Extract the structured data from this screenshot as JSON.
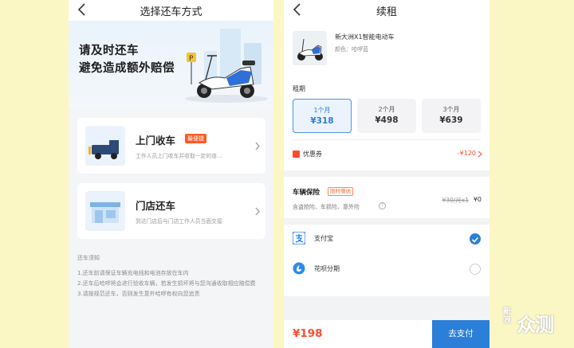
{
  "left": {
    "title": "选择还车方式",
    "banner": {
      "line1": "请及时还车",
      "line2": "避免造成额外赔偿"
    },
    "options": [
      {
        "title": "上门收车",
        "badge": "最便捷",
        "desc": "工作人员上门收车并收取一定的谘..."
      },
      {
        "title": "门店还车",
        "badge": "",
        "desc": "到达门店后与门店工作人员当面交接"
      }
    ],
    "notes": {
      "heading": "还车须知",
      "items": [
        "1.还车前请保证车辆充电线和电池存放在车内",
        "2.还车后哈啰将会进行验收车辆，若发生损坏将与您沟通收取相应赔偿费",
        "3.请按规范还车，否则发生意外哈啰有权向您追责"
      ]
    }
  },
  "right": {
    "title": "续租",
    "product": {
      "name": "新大洲X1智能电动车",
      "color": "颜色：哈啰蓝"
    },
    "rent": {
      "label": "租期",
      "options": [
        {
          "months": "1个月",
          "price": "¥318",
          "selected": true
        },
        {
          "months": "2个月",
          "price": "¥498",
          "selected": false
        },
        {
          "months": "3个月",
          "price": "¥639",
          "selected": false
        }
      ]
    },
    "coupon": {
      "label": "优惠券",
      "value": "-¥120"
    },
    "insurance": {
      "label": "车辆保险",
      "badge": "限时赠送",
      "desc": "含盗抢险、车损险、意外险",
      "old_price": "¥30/月x1",
      "price": "¥0"
    },
    "payment": [
      {
        "label": "支付宝",
        "selected": true
      },
      {
        "label": "花呗分期",
        "selected": false
      }
    ],
    "total": "¥198",
    "pay_button": "去支付"
  },
  "watermark": {
    "small": "新浪",
    "big": "众测"
  },
  "colors": {
    "accent": "#2b7fd8",
    "price": "#ff4b2b",
    "page_bg": "#fbf7c4"
  }
}
